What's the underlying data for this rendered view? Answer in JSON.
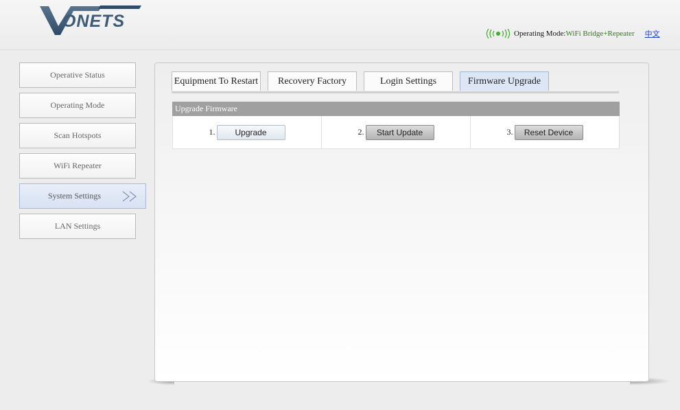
{
  "header": {
    "logo_text": "VONETS",
    "signal_icon": "wifi-signal-icon",
    "operating_mode_label": "Operating Mode:",
    "operating_mode_value": "WiFi Bridge+Repeater",
    "language_link": "中文",
    "colors": {
      "mode_value": "#2e7a17",
      "link": "#1a3fd6",
      "signal": "#3fae2a"
    }
  },
  "sidebar": {
    "items": [
      {
        "label": "Operative Status",
        "active": false
      },
      {
        "label": "Operating Mode",
        "active": false
      },
      {
        "label": "Scan Hotspots",
        "active": false
      },
      {
        "label": "WiFi Repeater",
        "active": false
      },
      {
        "label": "System Settings",
        "active": true,
        "icon": "double-chevron-right-icon"
      },
      {
        "label": "LAN Settings",
        "active": false
      }
    ]
  },
  "tabs": [
    {
      "label": "Equipment To Restart",
      "active": false
    },
    {
      "label": "Recovery Factory",
      "active": false
    },
    {
      "label": "Login Settings",
      "active": false
    },
    {
      "label": "Firmware Upgrade",
      "active": true
    }
  ],
  "firmware": {
    "header": "Upgrade Firmware",
    "steps": [
      {
        "number": "1.",
        "button": "Upgrade"
      },
      {
        "number": "2.",
        "button": "Start Update"
      },
      {
        "number": "3.",
        "button": "Reset Device"
      }
    ]
  }
}
